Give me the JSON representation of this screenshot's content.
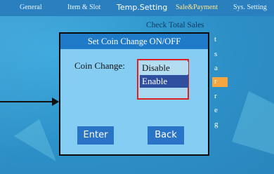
{
  "top_tabs": [
    {
      "label": "General"
    },
    {
      "label": "Item & Slot"
    },
    {
      "label": "Temp.Setting"
    },
    {
      "label": "Sale&Payment"
    },
    {
      "label": "Sys. Setting"
    }
  ],
  "background_menu": {
    "title": "Check Total Sales",
    "partial_letters": [
      "t",
      "s",
      "a",
      "r",
      "r",
      "e",
      "g"
    ]
  },
  "dialog": {
    "title": "Set Coin Change ON/OFF",
    "field_label": "Coin Change:",
    "options": [
      "Disable",
      "Enable"
    ],
    "selected": "Enable",
    "enter_label": "Enter",
    "back_label": "Back"
  },
  "colors": {
    "dialog_bg": "#86cdf4",
    "title_bar": "#1f7bc7",
    "selected_option": "#2f4f9e",
    "focus_border": "#e02020",
    "highlight_item": "#f4a640"
  }
}
